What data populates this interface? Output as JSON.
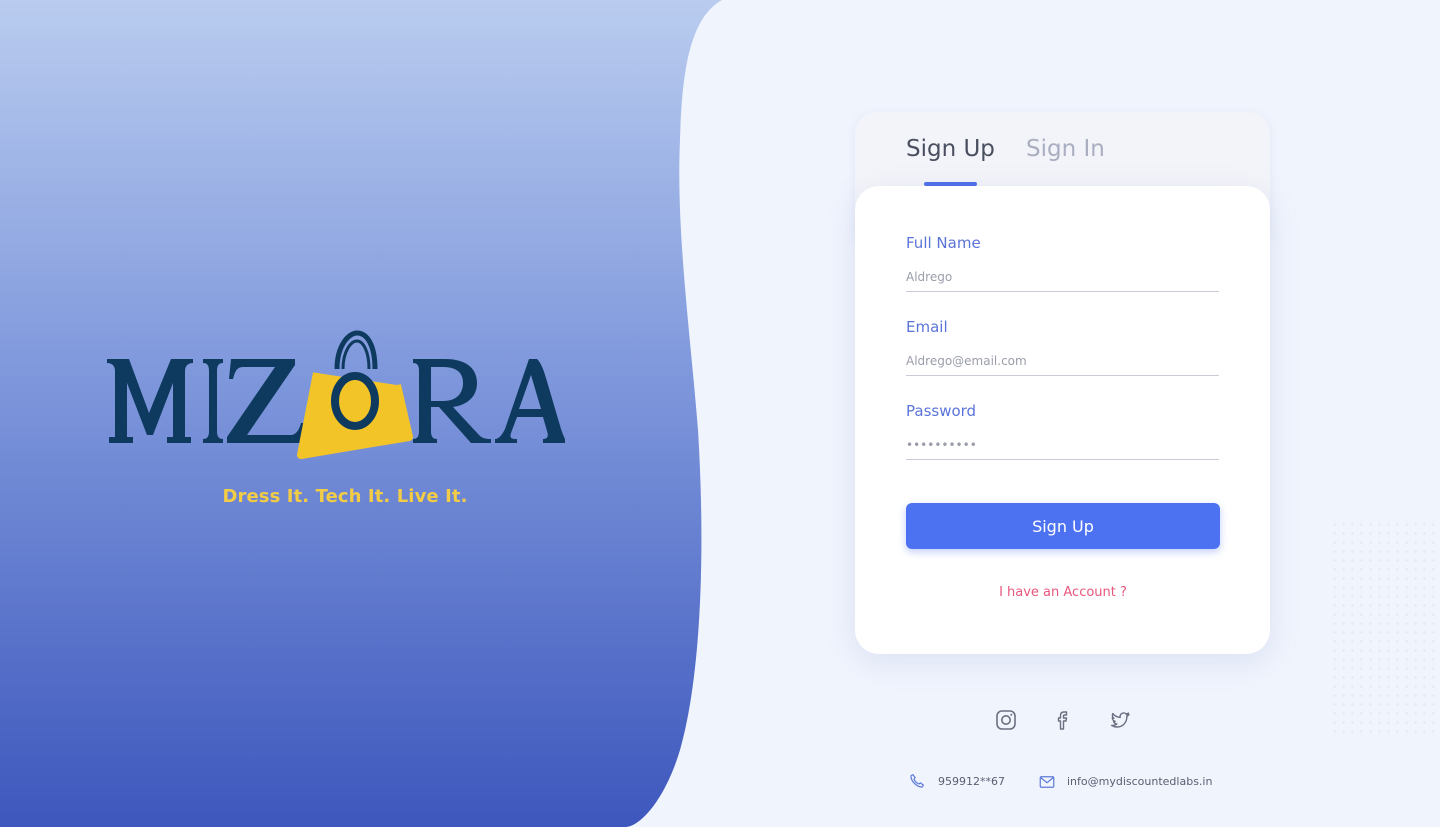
{
  "brand": {
    "name": "MIZORA",
    "tagline": "Dress It. Tech It. Live It.",
    "logo_colors": {
      "letters": "#0f3a5f",
      "bag": "#f2c428"
    },
    "tagline_color": "#f2cc45",
    "background_gradient": [
      "#b9ccef",
      "#3d57bd"
    ]
  },
  "auth": {
    "tabs": [
      {
        "label": "Sign Up",
        "active": true
      },
      {
        "label": "Sign In",
        "active": false
      }
    ],
    "fields": [
      {
        "label": "Full Name",
        "value": "Aldrego"
      },
      {
        "label": "Email",
        "value": "Aldrego@email.com"
      },
      {
        "label": "Password",
        "value": "••••••••••"
      }
    ],
    "submit_label": "Sign Up",
    "account_link": "I have an Account ?",
    "accent_color": "#4c72f2",
    "link_color": "#e8577e"
  },
  "social": [
    {
      "icon": "instagram-icon"
    },
    {
      "icon": "facebook-icon"
    },
    {
      "icon": "twitter-icon"
    }
  ],
  "contact": {
    "phone": "959912**67",
    "email": "info@mydiscountedlabs.in"
  }
}
